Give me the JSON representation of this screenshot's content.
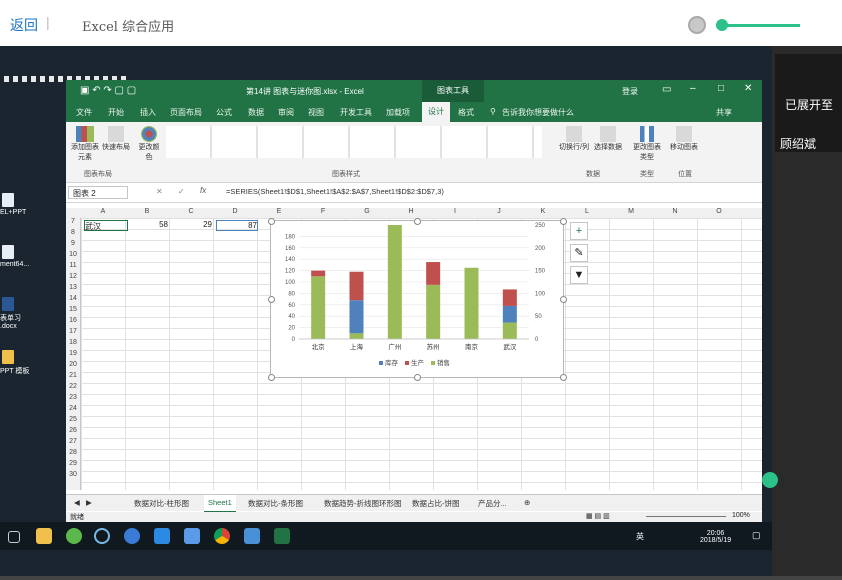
{
  "app": {
    "back_label": "返回",
    "separator": "|",
    "course_title": "Excel 综合应用"
  },
  "right_panel": {
    "note": "已展开至",
    "name": "顾绍斌"
  },
  "desktop_icons": [
    {
      "label": "EL+PPT",
      "icon": "document-icon"
    },
    {
      "label": "ment64...",
      "icon": "monitor-icon"
    },
    {
      "label": "表单习",
      "icon": "word-icon"
    },
    {
      "label": ".docx",
      "icon": "word-icon"
    },
    {
      "label": "PPT 模板",
      "icon": "folder-icon"
    }
  ],
  "excel": {
    "title": "第14讲 图表与迷你图.xlsx - Excel",
    "context_tab": "图表工具",
    "user": "登录",
    "tabs": [
      "文件",
      "开始",
      "插入",
      "页面布局",
      "公式",
      "数据",
      "审阅",
      "视图",
      "开发工具",
      "加载项",
      "设计",
      "格式"
    ],
    "active_tab": "设计",
    "tell_me": "告诉我你想要做什么",
    "share": "共享",
    "ribbon": {
      "groups": [
        {
          "label": "图表布局",
          "buttons": [
            "添加图表元素",
            "快速布局"
          ]
        },
        {
          "label": "",
          "buttons": [
            "更改颜色"
          ]
        },
        {
          "label": "图表样式",
          "buttons": []
        },
        {
          "label": "数据",
          "buttons": [
            "切换行/列",
            "选择数据"
          ]
        },
        {
          "label": "类型",
          "buttons": [
            "更改图表类型"
          ]
        },
        {
          "label": "位置",
          "buttons": [
            "移动图表"
          ]
        }
      ]
    },
    "name_box": "图表 2",
    "formula": "=SERIES(Sheet1!$D$1,Sheet1!$A$2:$A$7,Sheet1!$D$2:$D$7,3)",
    "columns": [
      "A",
      "B",
      "C",
      "D",
      "E",
      "F",
      "G",
      "H",
      "I",
      "J",
      "K",
      "L",
      "M",
      "N",
      "O"
    ],
    "rows": [
      "7",
      "8",
      "9",
      "10",
      "11",
      "12",
      "13",
      "14",
      "15",
      "16",
      "17",
      "18",
      "19",
      "20",
      "21",
      "22",
      "23",
      "24",
      "25",
      "26",
      "27",
      "28",
      "29",
      "30"
    ],
    "row7": {
      "a": "武汉",
      "b": "58",
      "c": "29",
      "d": "87"
    },
    "sheet_tabs": [
      "数据对比-柱形图",
      "Sheet1",
      "数据对比-条形图",
      "数据趋势-折线图环形图",
      "数据占比-饼图",
      "产品分..."
    ],
    "active_sheet": "Sheet1",
    "status": "就绪",
    "zoom": "100%"
  },
  "chart_data": {
    "type": "bar",
    "stacked": true,
    "categories": [
      "北京",
      "上海",
      "广州",
      "苏州",
      "南京",
      "武汉"
    ],
    "series": [
      {
        "name": "库存",
        "color": "#4f81bd",
        "values": [
          0,
          58,
          0,
          0,
          0,
          29
        ]
      },
      {
        "name": "生产",
        "color": "#c0504d",
        "values": [
          10,
          50,
          0,
          40,
          0,
          29
        ]
      },
      {
        "name": "销售",
        "color": "#9bbb59",
        "values": [
          110,
          10,
          200,
          95,
          125,
          29
        ]
      }
    ],
    "y_left_ticks": [
      "0",
      "20",
      "40",
      "60",
      "80",
      "100",
      "120",
      "140",
      "160",
      "180"
    ],
    "y_right_ticks": [
      "0",
      "50",
      "100",
      "150",
      "200",
      "250"
    ],
    "ylim": [
      0,
      250
    ],
    "legend_position": "bottom"
  },
  "taskbar": {
    "time": "20:06",
    "date": "2018/5/19",
    "ime": "英"
  }
}
